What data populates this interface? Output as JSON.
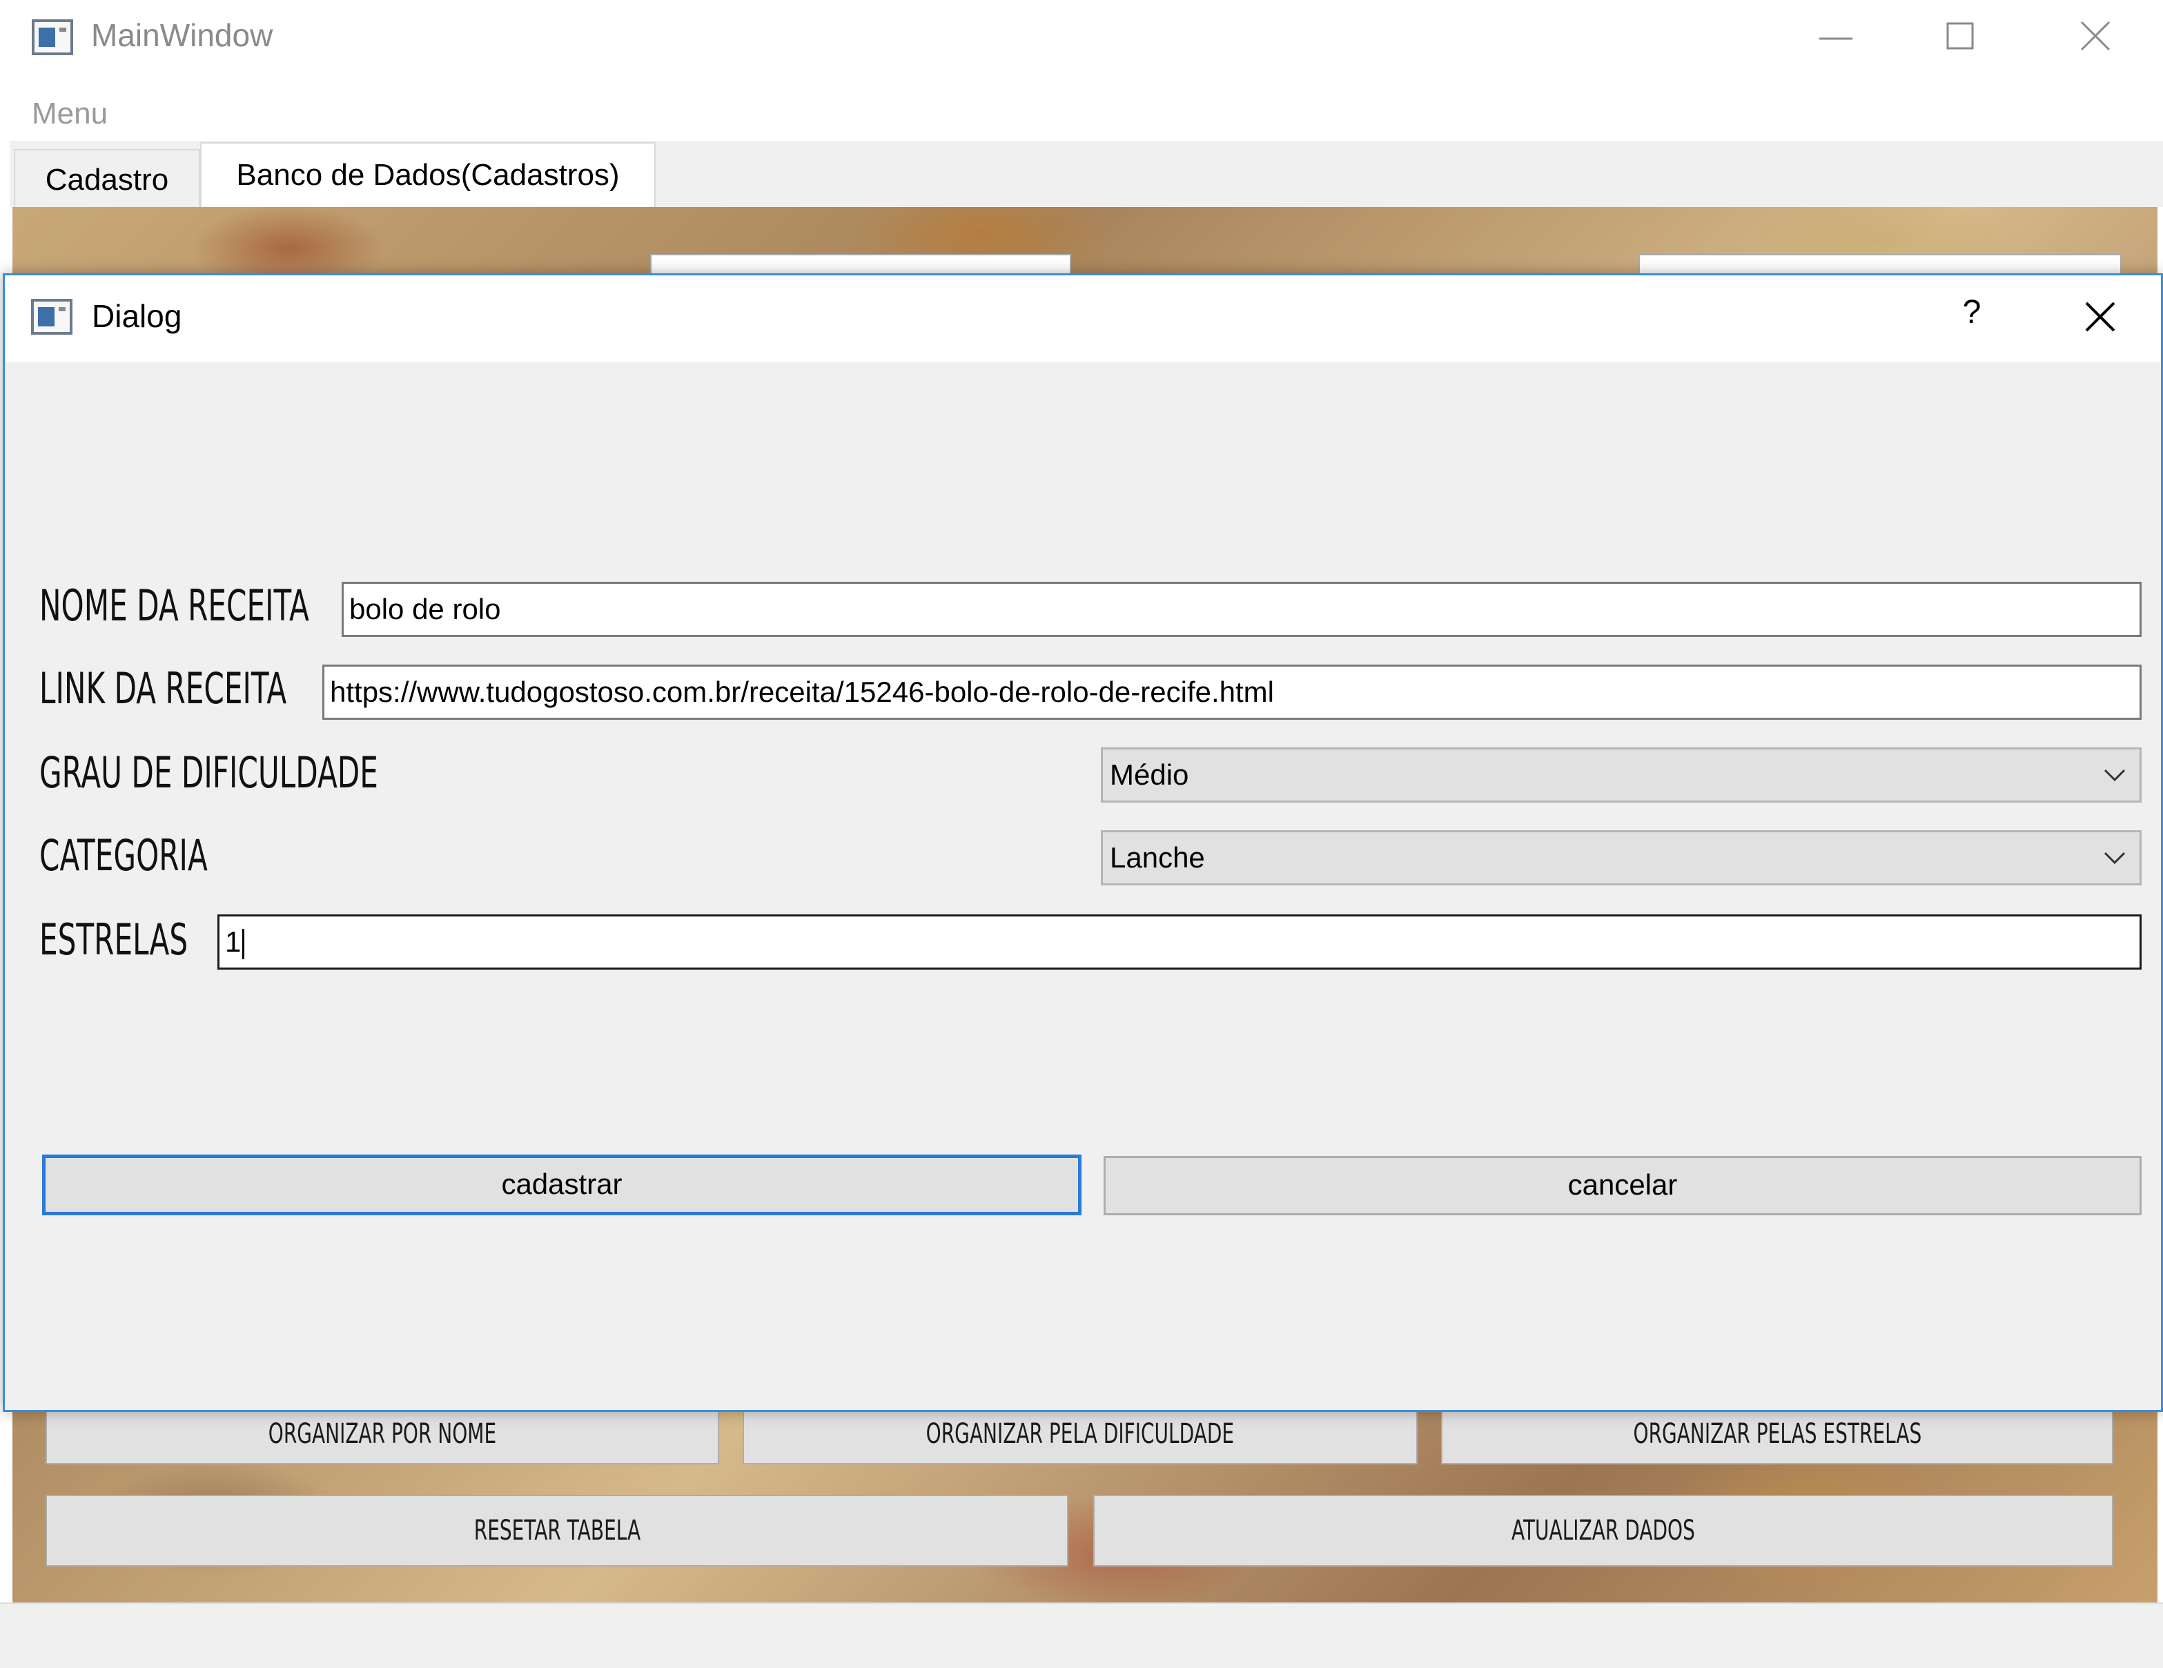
{
  "main_window": {
    "title": "MainWindow",
    "menu_label": "Menu",
    "tabs": [
      {
        "label": "Cadastro",
        "active": false
      },
      {
        "label": "Banco de Dados(Cadastros)",
        "active": true
      }
    ],
    "buttons": {
      "organizar_nome": "ORGANIZAR POR NOME",
      "organizar_dificuldade": "ORGANIZAR PELA DIFICULDADE",
      "organizar_estrelas": "ORGANIZAR PELAS ESTRELAS",
      "resetar_tabela": "RESETAR TABELA",
      "atualizar_dados": "ATUALIZAR DADOS"
    }
  },
  "dialog": {
    "title": "Dialog",
    "help_symbol": "?",
    "fields": {
      "nome": {
        "label": "NOME DA RECEITA",
        "value": "bolo de rolo"
      },
      "link": {
        "label": "LINK DA RECEITA",
        "value": "https://www.tudogostoso.com.br/receita/15246-bolo-de-rolo-de-recife.html"
      },
      "dificuldade": {
        "label": "GRAU DE DIFICULDADE",
        "selected": "Médio"
      },
      "categoria": {
        "label": "CATEGORIA",
        "selected": "Lanche"
      },
      "estrelas": {
        "label": "ESTRELAS",
        "value": "1"
      }
    },
    "buttons": {
      "cadastrar": "cadastrar",
      "cancelar": "cancelar"
    }
  },
  "icons": {
    "minimize": "minimize-icon",
    "maximize": "maximize-icon",
    "close": "close-icon",
    "help": "help-icon",
    "chevron": "chevron-down-icon"
  }
}
